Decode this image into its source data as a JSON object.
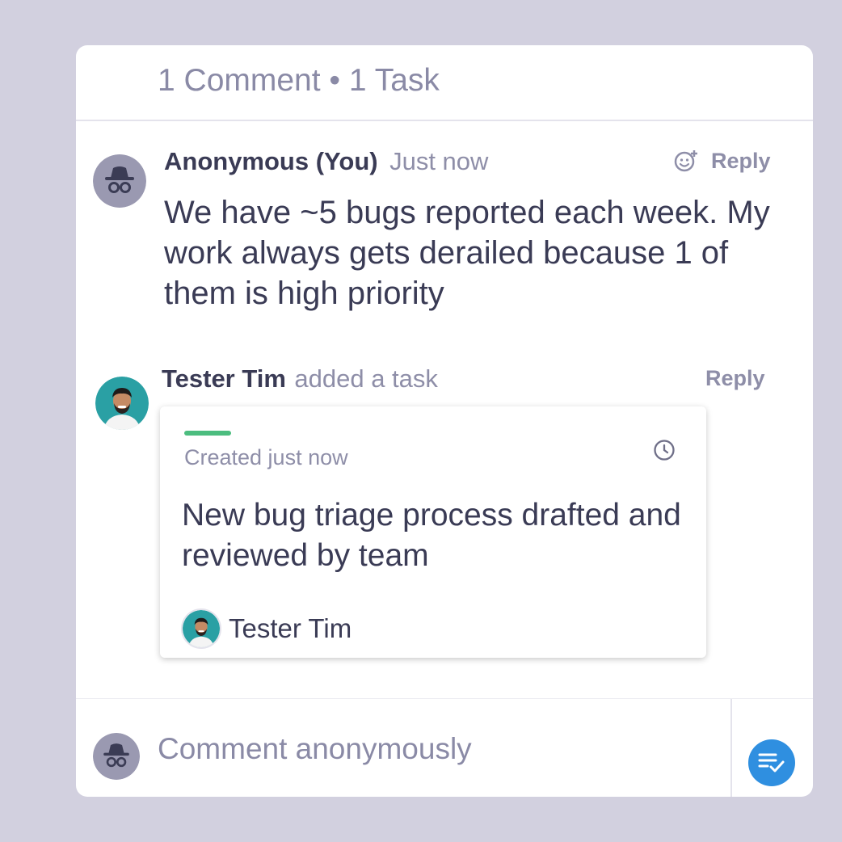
{
  "header": {
    "title": "1 Comment • 1 Task"
  },
  "comment": {
    "author": "Anonymous (You)",
    "time": "Just now",
    "reply_label": "Reply",
    "body": "We have ~5 bugs reported each week. My work always gets derailed because 1 of them is high priority"
  },
  "task_event": {
    "author": "Tester Tim",
    "action": "added a task",
    "reply_label": "Reply",
    "task": {
      "created": "Created just now",
      "title": "New bug triage process drafted and reviewed by team",
      "assignee": "Tester Tim",
      "status_color": "#4cbd7f"
    }
  },
  "composer": {
    "placeholder": "Comment anonymously",
    "task_button_icon": "checklist-icon",
    "accent": "#2f8fe0"
  }
}
